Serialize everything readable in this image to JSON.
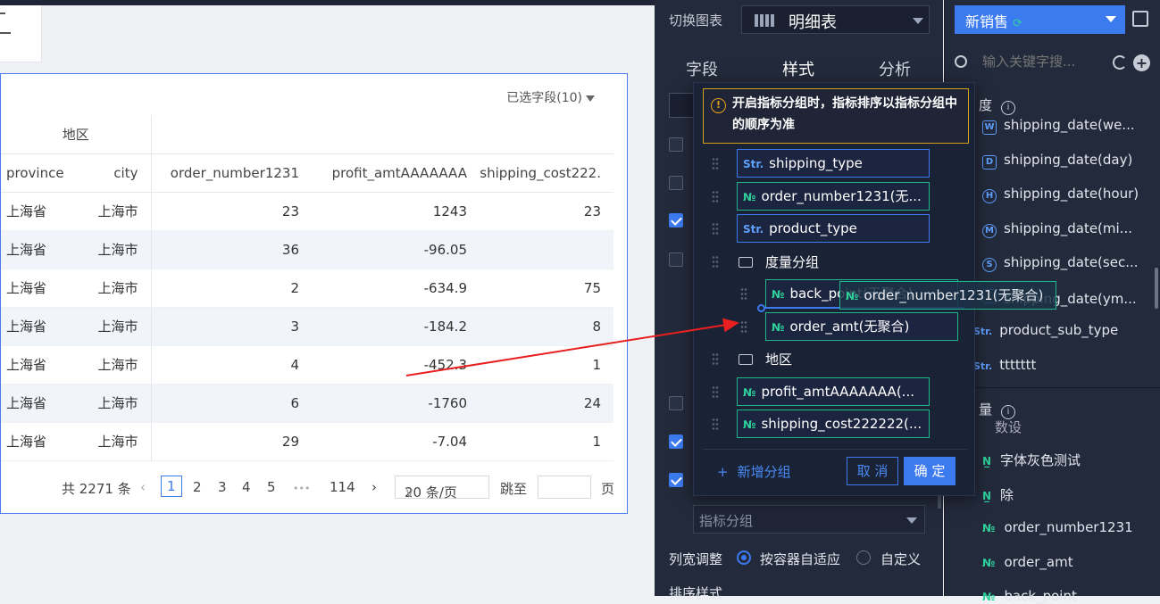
{
  "table": {
    "selected_fields": "已选字段(10)",
    "group_header": "地区",
    "columns": [
      "province",
      "city",
      "order_number1231",
      "profit_amtAAAAAAA",
      "shipping_cost222."
    ],
    "rows": [
      [
        "上海省",
        "上海市",
        "23",
        "1243",
        "23"
      ],
      [
        "上海省",
        "上海市",
        "36",
        "-96.05",
        ""
      ],
      [
        "上海省",
        "上海市",
        "2",
        "-634.9",
        "75"
      ],
      [
        "上海省",
        "上海市",
        "3",
        "-184.2",
        "8"
      ],
      [
        "上海省",
        "上海市",
        "4",
        "-452.3",
        "1"
      ],
      [
        "上海省",
        "上海市",
        "6",
        "-1760",
        "24"
      ],
      [
        "上海省",
        "上海市",
        "29",
        "-7.04",
        "1"
      ]
    ]
  },
  "pager": {
    "total": "共 2271 条",
    "pages": [
      "1",
      "2",
      "3",
      "4",
      "5"
    ],
    "ellipsis": "•••",
    "last": "114",
    "page_size": "20 条/页",
    "jump_label": "跳至",
    "page_suffix": "页"
  },
  "config": {
    "chart_switch_label": "切换图表",
    "chart_type": "明细表",
    "tabs": [
      "字段",
      "样式",
      "分析"
    ],
    "metric_group_placeholder": "指标分组",
    "col_width_label": "列宽调整",
    "col_width_opt1": "按容器自适应",
    "col_width_opt2": "自定义",
    "sort_label": "排序样式"
  },
  "popover": {
    "warning": "开启指标分组时，指标排序以指标分组中的顺序为准",
    "warning_icon": "!",
    "items": [
      {
        "prefix": "Str.",
        "label": "shipping_type",
        "kind": "dim"
      },
      {
        "prefix": "№",
        "label": "order_number1231(无...",
        "kind": "mea"
      },
      {
        "prefix": "Str.",
        "label": "product_type",
        "kind": "dim"
      }
    ],
    "group1": "度量分组",
    "group1_items": [
      {
        "prefix": "№",
        "label": "back_point(无聚合)"
      },
      {
        "prefix": "№",
        "label": "order_amt(无聚合)"
      }
    ],
    "group2": "地区",
    "tail_items": [
      {
        "prefix": "№",
        "label": "profit_amtAAAAAAA(..."
      },
      {
        "prefix": "№",
        "label": "shipping_cost222222(..."
      }
    ],
    "drag_ghost": {
      "prefix": "№",
      "label": "order_number1231(无聚合)"
    },
    "add_group": "新增分组",
    "cancel": "取 消",
    "ok": "确 定"
  },
  "dataset": {
    "name": "新销售",
    "search_placeholder": "输入关键字搜...",
    "dim_header": "度",
    "dims": [
      {
        "badge": "W",
        "label": "shipping_date(we..."
      },
      {
        "badge": "D",
        "label": "shipping_date(day)"
      },
      {
        "badge": "H",
        "label": "shipping_date(hour)",
        "circle": true
      },
      {
        "badge": "M",
        "label": "shipping_date(mi...",
        "circle": true
      },
      {
        "badge": "S",
        "label": "shipping_date(sec...",
        "circle": true
      },
      {
        "badge": "",
        "label": "shipping_date(ym..."
      }
    ],
    "str_dims": [
      {
        "badge": "Str.",
        "label": "product_sub_type"
      },
      {
        "badge": "Str.",
        "label": "ttttttt"
      }
    ],
    "mea_header": "量",
    "mea_partial": "数设",
    "measures": [
      {
        "badge": "N̲",
        "label": "字体灰色测试"
      },
      {
        "badge": "N̲",
        "label": "除"
      },
      {
        "badge": "№",
        "label": "order_number1231"
      },
      {
        "badge": "№",
        "label": "order_amt"
      },
      {
        "badge": "№",
        "label": "back_point"
      }
    ]
  }
}
